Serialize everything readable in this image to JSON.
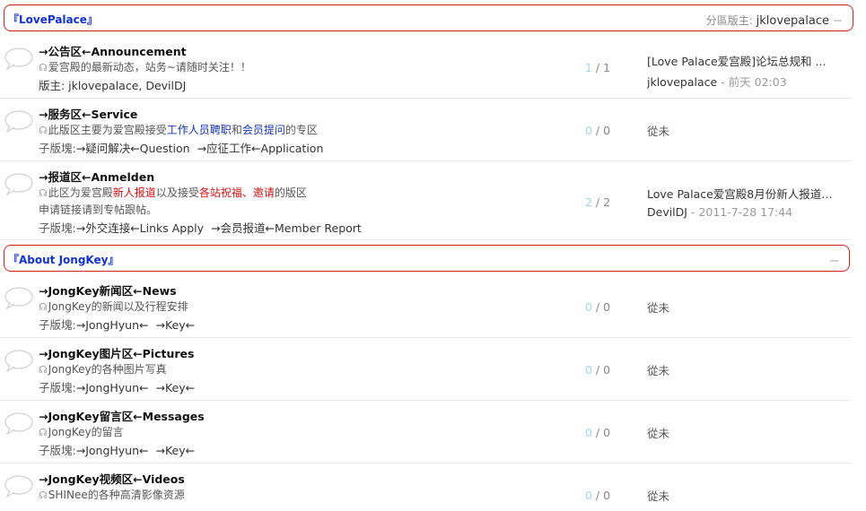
{
  "categories": [
    {
      "title": "『LovePalace』",
      "moderator_label": "分區版主:",
      "moderator": "jklovepalace"
    },
    {
      "title": "『About JongKey』"
    }
  ],
  "forums": [
    {
      "name": "→公告区←Announcement",
      "desc": "爱宫殿的最新动态，站务~请随时关注！！",
      "line3": "版主: jklovepalace, DevilDJ",
      "today": "1",
      "total": "1",
      "last_title": "[Love Palace爱宫殿]论坛总规和 ...",
      "last_author": "jklovepalace",
      "last_time": "- 前天 02:03"
    },
    {
      "name": "→服务区←Service",
      "desc_a": "此版区主要为爱宫殿接受",
      "desc_b": "工作人员聘职",
      "desc_c": "和",
      "desc_d": "会员提问",
      "desc_e": "的专区",
      "sub_label": "子版塊:",
      "subs": [
        "→疑问解决←Question",
        "→应征工作←Application"
      ],
      "today": "0",
      "total": "0",
      "never": "從未"
    },
    {
      "name": "→报道区←Anmelden",
      "desc_a": "此区为爱宫殿",
      "desc_b": "新人报道",
      "desc_c": "以及接受",
      "desc_d": "各站祝福、邀请",
      "desc_e": "的版区",
      "desc2": "申请链接请到专帖跟帖。",
      "sub_label": "子版塊:",
      "subs": [
        "→外交连接←Links Apply",
        "→会员报道←Member Report"
      ],
      "today": "2",
      "total": "2",
      "last_title": "Love Palace爱宫殿8月份新人报道 ...",
      "last_author": "DevilDJ",
      "last_time": "- 2011-7-28 17:44"
    },
    {
      "name": "→JongKey新闻区←News",
      "desc": "JongKey的新闻以及行程安排",
      "sub_label": "子版塊:",
      "subs": [
        "→JongHyun←",
        "→Key←"
      ],
      "today": "0",
      "total": "0",
      "never": "從未"
    },
    {
      "name": "→JongKey图片区←Pictures",
      "desc": "JongKey的各种图片写真",
      "sub_label": "子版塊:",
      "subs": [
        "→JongHyun←",
        "→Key←"
      ],
      "today": "0",
      "total": "0",
      "never": "從未"
    },
    {
      "name": "→JongKey留言区←Messages",
      "desc": "JongKey的留言",
      "sub_label": "子版塊:",
      "subs": [
        "→JongHyun←",
        "→Key←"
      ],
      "today": "0",
      "total": "0",
      "never": "從未"
    },
    {
      "name": "→JongKey视频区←Videos",
      "desc": "SHINee的各种高清影像资源",
      "today": "0",
      "total": "0",
      "never": "從未"
    }
  ],
  "colors": {
    "header_border": "#cc2222",
    "header_title": "#1133cc",
    "today_count": "#9dd8e8",
    "highlight_red": "#cc1111",
    "highlight_blue": "#1133aa"
  }
}
